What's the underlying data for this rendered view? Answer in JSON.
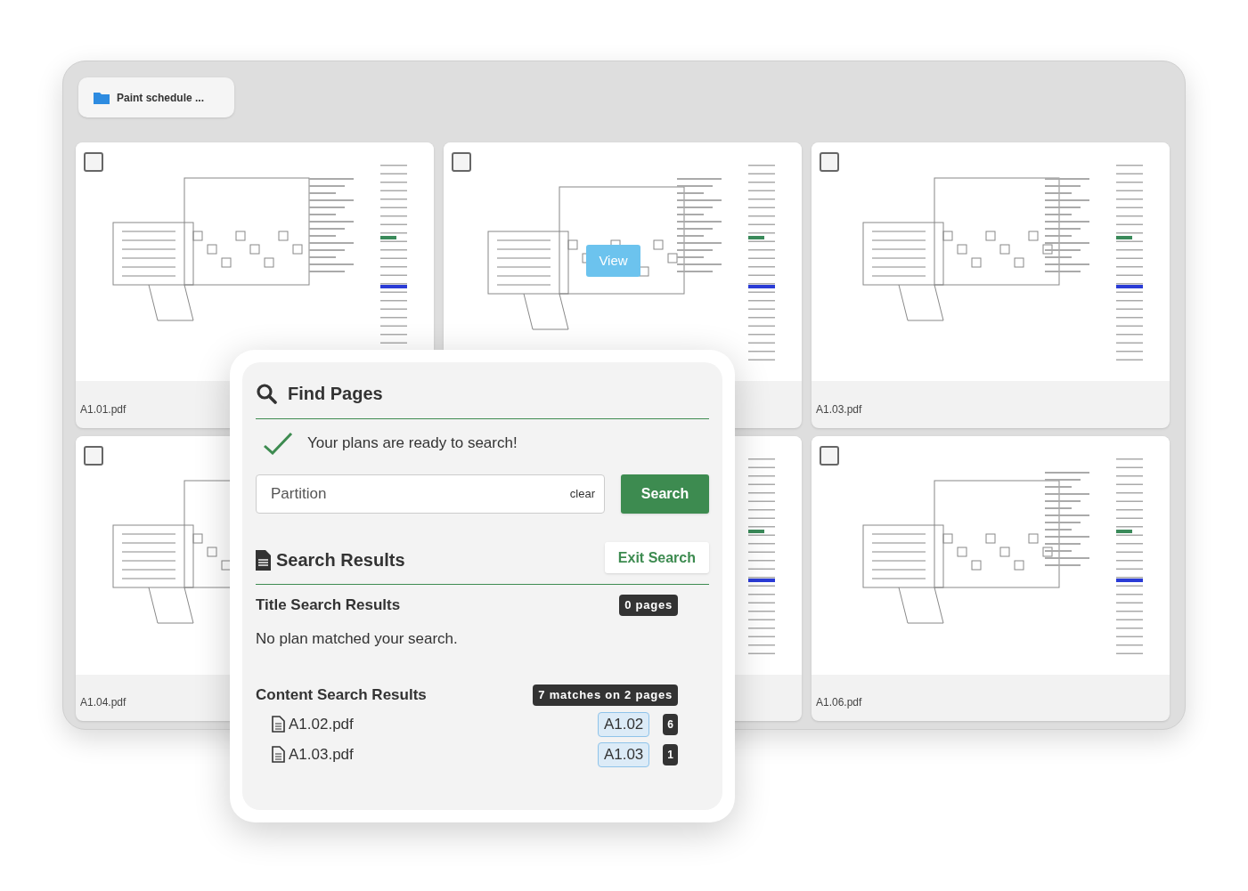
{
  "folder_tab": {
    "label": "Paint schedule ..."
  },
  "cards": [
    {
      "kind": "plan",
      "file": "A1.01.pdf",
      "checked": false
    },
    {
      "kind": "plan",
      "checked": false,
      "hover_button": "View"
    },
    {
      "kind": "plan",
      "file": "A1.03.pdf",
      "checked": false
    },
    {
      "kind": "plan",
      "file": "A1.04.pdf",
      "checked": false
    },
    {
      "kind": "plan"
    },
    {
      "kind": "plan",
      "file": "A1.06.pdf",
      "checked": false
    }
  ],
  "find_panel": {
    "title": "Find Pages",
    "status": "Your plans are ready to search!",
    "search_field": {
      "value": "Partition",
      "clear": "clear"
    },
    "search_button": "Search",
    "results_title": "Search Results",
    "exit_button": "Exit Search",
    "title_results": {
      "heading": "Title Search Results",
      "badge": "0 pages",
      "message": "No plan matched your search."
    },
    "content_results": {
      "heading": "Content Search Results",
      "badge": "7 matches on 2 pages",
      "files": [
        {
          "name": "A1.02.pdf",
          "sheet": "A1.02",
          "count": "6"
        },
        {
          "name": "A1.03.pdf",
          "sheet": "A1.03",
          "count": "1"
        }
      ]
    }
  }
}
